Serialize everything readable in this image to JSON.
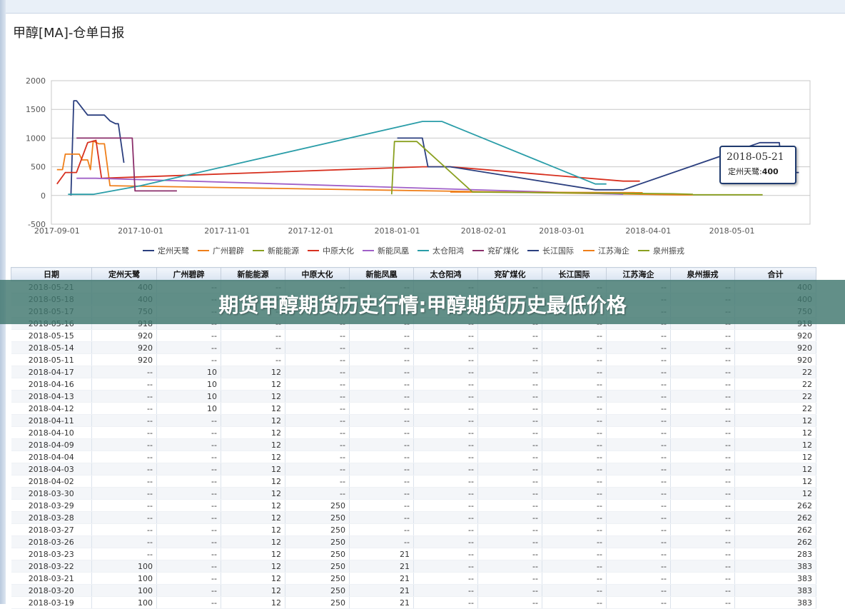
{
  "banner_text": "期货甲醇期货历史行情:甲醇期货历史最低价格",
  "chart_data": {
    "type": "line",
    "title": "甲醇[MA]-仓单日报",
    "ylim": [
      -500,
      2000
    ],
    "yticks": [
      -500,
      0,
      500,
      1000,
      1500,
      2000
    ],
    "xlim": [
      "2017-08-30",
      "2018-05-29"
    ],
    "xticks": [
      "2017-09-01",
      "2017-10-01",
      "2017-11-01",
      "2017-12-01",
      "2018-01-01",
      "2018-02-01",
      "2018-03-01",
      "2018-04-01",
      "2018-05-01"
    ],
    "grid": true,
    "legend_position": "bottom",
    "series": [
      {
        "name": "定州天鹭",
        "color": "#2b3f7f",
        "points": [
          [
            "2017-09-06",
            0
          ],
          [
            "2017-09-07",
            1650
          ],
          [
            "2017-09-08",
            1650
          ],
          [
            "2017-09-12",
            1400
          ],
          [
            "2017-09-18",
            1400
          ],
          [
            "2017-09-20",
            1300
          ],
          [
            "2017-09-22",
            1250
          ],
          [
            "2017-09-23",
            1250
          ],
          [
            "2017-09-25",
            570
          ]
        ]
      },
      {
        "name": "广州碧辟",
        "color": "#ef7f1a",
        "points": [
          [
            "2017-09-01",
            450
          ],
          [
            "2017-09-03",
            450
          ],
          [
            "2017-09-04",
            720
          ],
          [
            "2017-09-09",
            720
          ],
          [
            "2017-09-10",
            620
          ],
          [
            "2017-09-12",
            620
          ],
          [
            "2017-09-13",
            450
          ],
          [
            "2017-09-14",
            950
          ],
          [
            "2017-09-16",
            900
          ],
          [
            "2017-09-18",
            900
          ],
          [
            "2017-09-20",
            170
          ],
          [
            "2018-04-12",
            10
          ],
          [
            "2018-04-17",
            10
          ]
        ]
      },
      {
        "name": "新能能源",
        "color": "#8aa020",
        "points": [
          [
            "2018-04-17",
            12
          ],
          [
            "2018-05-12",
            12
          ]
        ]
      },
      {
        "name": "中原大化",
        "color": "#d7301f",
        "points": [
          [
            "2017-09-01",
            200
          ],
          [
            "2017-09-04",
            400
          ],
          [
            "2017-09-08",
            400
          ],
          [
            "2017-09-12",
            920
          ],
          [
            "2017-09-15",
            960
          ],
          [
            "2017-09-17",
            300
          ],
          [
            "2018-01-10",
            500
          ],
          [
            "2018-01-20",
            500
          ],
          [
            "2018-03-23",
            250
          ],
          [
            "2018-03-29",
            250
          ]
        ]
      },
      {
        "name": "新能凤凰",
        "color": "#a060c8",
        "points": [
          [
            "2017-09-08",
            300
          ],
          [
            "2017-09-15",
            300
          ],
          [
            "2018-03-23",
            21
          ]
        ]
      },
      {
        "name": "太仓阳鸿",
        "color": "#2a9da8",
        "points": [
          [
            "2017-09-05",
            20
          ],
          [
            "2017-09-14",
            20
          ],
          [
            "2017-10-01",
            170
          ],
          [
            "2018-01-10",
            1290
          ],
          [
            "2018-01-17",
            1290
          ],
          [
            "2018-03-13",
            200
          ],
          [
            "2018-03-17",
            200
          ]
        ]
      },
      {
        "name": "兖矿煤化",
        "color": "#8b2f6b",
        "points": [
          [
            "2017-09-08",
            1000
          ],
          [
            "2017-09-28",
            1000
          ],
          [
            "2017-09-29",
            80
          ],
          [
            "2017-10-14",
            80
          ]
        ]
      },
      {
        "name": "长江国际",
        "color": "#2b3f7f",
        "points": [
          [
            "2018-01-01",
            1000
          ],
          [
            "2018-01-10",
            1000
          ],
          [
            "2018-01-12",
            500
          ],
          [
            "2018-01-20",
            500
          ],
          [
            "2018-03-13",
            100
          ],
          [
            "2018-03-23",
            100
          ],
          [
            "2018-05-11",
            920
          ],
          [
            "2018-05-18",
            920
          ],
          [
            "2018-05-19",
            400
          ],
          [
            "2018-05-25",
            400
          ]
        ]
      },
      {
        "name": "江苏海企",
        "color": "#ef7f1a",
        "points": [
          [
            "2018-01-20",
            60
          ],
          [
            "2018-03-30",
            50
          ]
        ]
      },
      {
        "name": "泉州振戎",
        "color": "#8aa020",
        "points": [
          [
            "2017-12-30",
            20
          ],
          [
            "2017-12-31",
            940
          ],
          [
            "2018-01-08",
            940
          ],
          [
            "2018-01-28",
            60
          ],
          [
            "2018-04-10",
            30
          ],
          [
            "2018-04-17",
            20
          ]
        ]
      }
    ]
  },
  "tooltip": {
    "date": "2018-05-21",
    "series": "定州天鹭",
    "value": "400"
  },
  "table": {
    "headers": [
      "日期",
      "定州天鹭",
      "广州碧辟",
      "新能能源",
      "中原大化",
      "新能凤凰",
      "太仓阳鸿",
      "兖矿煤化",
      "长江国际",
      "江苏海企",
      "泉州振戎",
      "合计"
    ],
    "rows": [
      [
        "2018-05-21",
        "400",
        "--",
        "--",
        "--",
        "--",
        "--",
        "--",
        "--",
        "--",
        "--",
        "400"
      ],
      [
        "2018-05-18",
        "400",
        "--",
        "--",
        "--",
        "--",
        "--",
        "--",
        "--",
        "--",
        "--",
        "400"
      ],
      [
        "2018-05-17",
        "750",
        "--",
        "--",
        "--",
        "--",
        "--",
        "--",
        "--",
        "--",
        "--",
        "750"
      ],
      [
        "2018-05-16",
        "918",
        "--",
        "--",
        "--",
        "--",
        "--",
        "--",
        "--",
        "--",
        "--",
        "918"
      ],
      [
        "2018-05-15",
        "920",
        "--",
        "--",
        "--",
        "--",
        "--",
        "--",
        "--",
        "--",
        "--",
        "920"
      ],
      [
        "2018-05-14",
        "920",
        "--",
        "--",
        "--",
        "--",
        "--",
        "--",
        "--",
        "--",
        "--",
        "920"
      ],
      [
        "2018-05-11",
        "920",
        "--",
        "--",
        "--",
        "--",
        "--",
        "--",
        "--",
        "--",
        "--",
        "920"
      ],
      [
        "2018-04-17",
        "--",
        "10",
        "12",
        "--",
        "--",
        "--",
        "--",
        "--",
        "--",
        "--",
        "22"
      ],
      [
        "2018-04-16",
        "--",
        "10",
        "12",
        "--",
        "--",
        "--",
        "--",
        "--",
        "--",
        "--",
        "22"
      ],
      [
        "2018-04-13",
        "--",
        "10",
        "12",
        "--",
        "--",
        "--",
        "--",
        "--",
        "--",
        "--",
        "22"
      ],
      [
        "2018-04-12",
        "--",
        "10",
        "12",
        "--",
        "--",
        "--",
        "--",
        "--",
        "--",
        "--",
        "22"
      ],
      [
        "2018-04-11",
        "--",
        "--",
        "12",
        "--",
        "--",
        "--",
        "--",
        "--",
        "--",
        "--",
        "12"
      ],
      [
        "2018-04-10",
        "--",
        "--",
        "12",
        "--",
        "--",
        "--",
        "--",
        "--",
        "--",
        "--",
        "12"
      ],
      [
        "2018-04-09",
        "--",
        "--",
        "12",
        "--",
        "--",
        "--",
        "--",
        "--",
        "--",
        "--",
        "12"
      ],
      [
        "2018-04-04",
        "--",
        "--",
        "12",
        "--",
        "--",
        "--",
        "--",
        "--",
        "--",
        "--",
        "12"
      ],
      [
        "2018-04-03",
        "--",
        "--",
        "12",
        "--",
        "--",
        "--",
        "--",
        "--",
        "--",
        "--",
        "12"
      ],
      [
        "2018-04-02",
        "--",
        "--",
        "12",
        "--",
        "--",
        "--",
        "--",
        "--",
        "--",
        "--",
        "12"
      ],
      [
        "2018-03-30",
        "--",
        "--",
        "12",
        "--",
        "--",
        "--",
        "--",
        "--",
        "--",
        "--",
        "12"
      ],
      [
        "2018-03-29",
        "--",
        "--",
        "12",
        "250",
        "--",
        "--",
        "--",
        "--",
        "--",
        "--",
        "262"
      ],
      [
        "2018-03-28",
        "--",
        "--",
        "12",
        "250",
        "--",
        "--",
        "--",
        "--",
        "--",
        "--",
        "262"
      ],
      [
        "2018-03-27",
        "--",
        "--",
        "12",
        "250",
        "--",
        "--",
        "--",
        "--",
        "--",
        "--",
        "262"
      ],
      [
        "2018-03-26",
        "--",
        "--",
        "12",
        "250",
        "--",
        "--",
        "--",
        "--",
        "--",
        "--",
        "262"
      ],
      [
        "2018-03-23",
        "--",
        "--",
        "12",
        "250",
        "21",
        "--",
        "--",
        "--",
        "--",
        "--",
        "283"
      ],
      [
        "2018-03-22",
        "100",
        "--",
        "12",
        "250",
        "21",
        "--",
        "--",
        "--",
        "--",
        "--",
        "383"
      ],
      [
        "2018-03-21",
        "100",
        "--",
        "12",
        "250",
        "21",
        "--",
        "--",
        "--",
        "--",
        "--",
        "383"
      ],
      [
        "2018-03-20",
        "100",
        "--",
        "12",
        "250",
        "21",
        "--",
        "--",
        "--",
        "--",
        "--",
        "383"
      ],
      [
        "2018-03-19",
        "100",
        "--",
        "12",
        "250",
        "21",
        "--",
        "--",
        "--",
        "--",
        "--",
        "383"
      ]
    ]
  }
}
